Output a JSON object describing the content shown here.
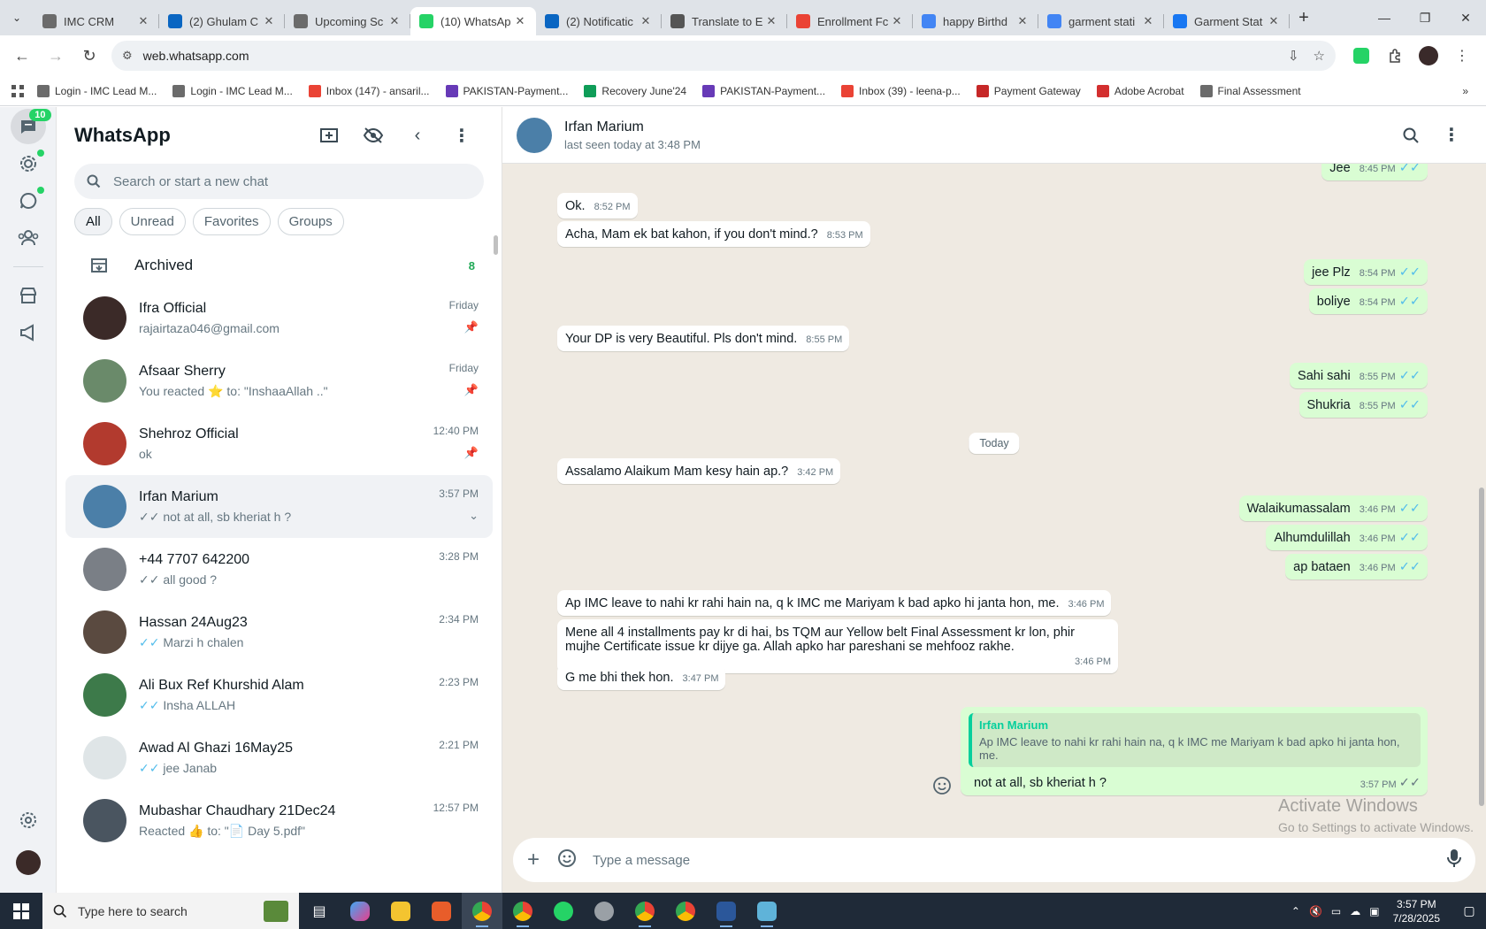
{
  "browser": {
    "tabs": [
      {
        "title": "IMC CRM",
        "color": "#6b6b6b"
      },
      {
        "title": "(2) Ghulam C",
        "color": "#0a66c2"
      },
      {
        "title": "Upcoming Sc",
        "color": "#6b6b6b"
      },
      {
        "title": "(10) WhatsAp",
        "color": "#25d366",
        "active": true
      },
      {
        "title": "(2) Notificatic",
        "color": "#0a66c2"
      },
      {
        "title": "Translate to E",
        "color": "#555555"
      },
      {
        "title": "Enrollment Fc",
        "color": "#ea4335"
      },
      {
        "title": "happy Birthd",
        "color": "#4285f4"
      },
      {
        "title": "garment stati",
        "color": "#4285f4"
      },
      {
        "title": "Garment Stat",
        "color": "#1877f2"
      }
    ],
    "url": "web.whatsapp.com",
    "bookmarks": [
      {
        "label": "Login - IMC Lead M...",
        "color": "#6b6b6b"
      },
      {
        "label": "Login - IMC Lead M...",
        "color": "#6b6b6b"
      },
      {
        "label": "Inbox (147) - ansaril...",
        "color": "#ea4335"
      },
      {
        "label": "PAKISTAN-Payment...",
        "color": "#673ab7"
      },
      {
        "label": "Recovery June'24",
        "color": "#0f9d58"
      },
      {
        "label": "PAKISTAN-Payment...",
        "color": "#673ab7"
      },
      {
        "label": "Inbox (39) - leena-p...",
        "color": "#ea4335"
      },
      {
        "label": "Payment Gateway",
        "color": "#c62828"
      },
      {
        "label": "Adobe Acrobat",
        "color": "#d32f2f"
      },
      {
        "label": "Final Assessment",
        "color": "#6b6b6b"
      }
    ]
  },
  "rail": {
    "chats_badge": "10"
  },
  "sidebar": {
    "title": "WhatsApp",
    "search_placeholder": "Search or start a new chat",
    "filters": [
      "All",
      "Unread",
      "Favorites",
      "Groups"
    ],
    "archived_label": "Archived",
    "archived_count": "8",
    "chats": [
      {
        "name": "Ifra Official",
        "preview": "rajairtaza046@gmail.com",
        "time": "Friday",
        "pinned": true,
        "avatar": "#3b2a28"
      },
      {
        "name": "Afsaar Sherry",
        "preview": "You reacted ⭐ to: \"InshaaAllah ..\"",
        "time": "Friday",
        "pinned": true,
        "avatar": "#6a8a6a"
      },
      {
        "name": "Shehroz Official",
        "preview": "ok",
        "time": "12:40 PM",
        "pinned": true,
        "avatar": "#b23a2e"
      },
      {
        "name": "Irfan Marium",
        "preview": "not at all, sb kheriat h ?",
        "time": "3:57 PM",
        "tick": "grey",
        "selected": true,
        "avatar": "#4b7fa8"
      },
      {
        "name": "+44 7707 642200",
        "preview": "all good ?",
        "time": "3:28 PM",
        "tick": "grey",
        "avatar": "#7a7f86"
      },
      {
        "name": "Hassan 24Aug23",
        "preview": "Marzi h chalen",
        "time": "2:34 PM",
        "tick": "blue",
        "avatar": "#5a4a40"
      },
      {
        "name": "Ali Bux Ref Khurshid Alam",
        "preview": "Insha ALLAH",
        "time": "2:23 PM",
        "tick": "blue",
        "avatar": "#3d7a4a"
      },
      {
        "name": "Awad Al Ghazi 16May25",
        "preview": "jee Janab",
        "time": "2:21 PM",
        "tick": "blue",
        "avatar": "#dfe5e7"
      },
      {
        "name": "Mubashar Chaudhary 21Dec24",
        "preview": "Reacted 👍 to: \"📄 Day 5.pdf\"",
        "time": "12:57 PM",
        "avatar": "#4a5560"
      }
    ]
  },
  "conversation": {
    "name": "Irfan Marium",
    "status": "last seen today at 3:48 PM",
    "messages": [
      {
        "dir": "out",
        "text": "Jee",
        "time": "8:45 PM"
      },
      {
        "dir": "in",
        "text": "Ok.",
        "time": "8:52 PM"
      },
      {
        "dir": "in",
        "text": "Acha, Mam ek bat kahon, if you don't mind.?",
        "time": "8:53 PM"
      },
      {
        "dir": "out",
        "text": "jee Plz",
        "time": "8:54 PM"
      },
      {
        "dir": "out",
        "text": "boliye",
        "time": "8:54 PM"
      },
      {
        "dir": "in",
        "text": "Your DP is very Beautiful. Pls don't mind.",
        "time": "8:55 PM"
      },
      {
        "dir": "out",
        "text": "Sahi sahi",
        "time": "8:55 PM"
      },
      {
        "dir": "out",
        "text": "Shukria",
        "time": "8:55 PM"
      },
      {
        "dir": "date",
        "text": "Today"
      },
      {
        "dir": "in",
        "text": "Assalamo Alaikum Mam kesy hain ap.?",
        "time": "3:42 PM"
      },
      {
        "dir": "out",
        "text": "Walaikumassalam",
        "time": "3:46 PM"
      },
      {
        "dir": "out",
        "text": "Alhumdulillah",
        "time": "3:46 PM"
      },
      {
        "dir": "out",
        "text": "ap bataen",
        "time": "3:46 PM"
      },
      {
        "dir": "in",
        "text": "Ap IMC leave to nahi kr rahi hain na, q k IMC me Mariyam k bad apko hi janta hon, me.",
        "time": "3:46 PM"
      },
      {
        "dir": "in",
        "text": "Mene all 4 installments pay kr di hai, bs TQM aur Yellow belt Final Assessment kr lon, phir mujhe Certificate issue kr dijye ga. Allah apko har pareshani se mehfooz rakhe.",
        "time": "3:46 PM"
      },
      {
        "dir": "in",
        "text": "G me bhi thek hon.",
        "time": "3:47 PM"
      }
    ],
    "reply": {
      "quote_name": "Irfan Marium",
      "quote_text": "Ap IMC leave to nahi kr rahi hain na, q k IMC me Mariyam k bad apko hi janta hon, me.",
      "text": "not at all, sb kheriat h ?",
      "time": "3:57 PM"
    },
    "composer_placeholder": "Type a message",
    "watermark_title": "Activate Windows",
    "watermark_sub": "Go to Settings to activate Windows."
  },
  "taskbar": {
    "search_placeholder": "Type here to search",
    "time": "3:57 PM",
    "date": "7/28/2025"
  }
}
